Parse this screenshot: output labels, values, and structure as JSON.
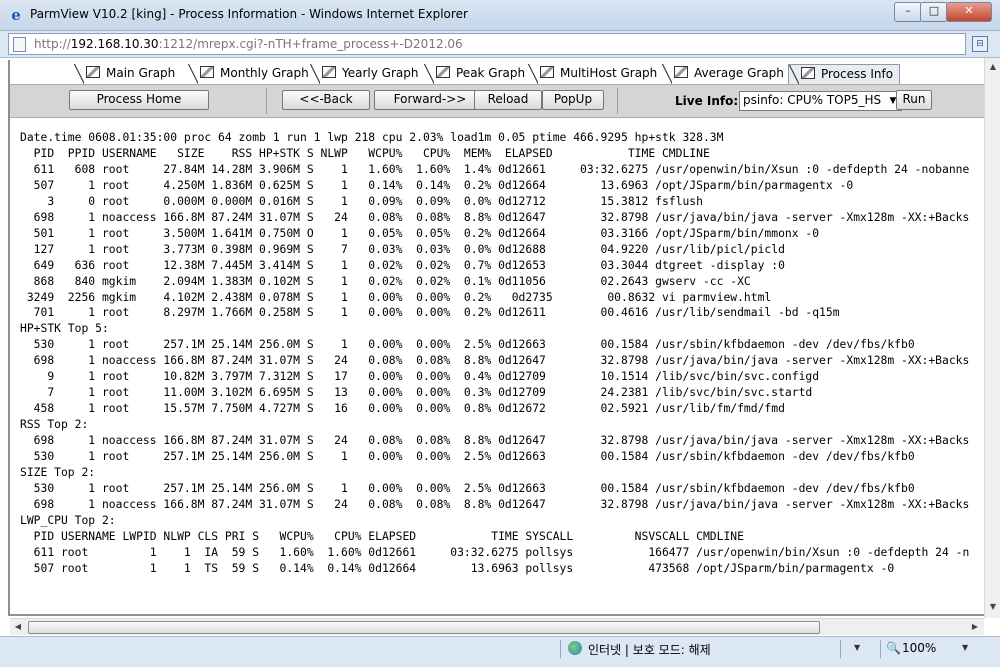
{
  "window": {
    "title": "ParmView V10.2 [king] - Process Information - Windows Internet Explorer"
  },
  "address": {
    "url_prefix": "http://",
    "host": "192.168.10.30",
    "url_rest": ":1212/mrepx.cgi?-nTH+frame_process+-D2012.06"
  },
  "tabs": [
    "Main Graph",
    "Monthly Graph",
    "Yearly Graph",
    "Peak Graph",
    "MultiHost Graph",
    "Average Graph",
    "Process Info"
  ],
  "toolbar": {
    "process_home": "Process Home",
    "back": "<<-Back",
    "forward": "Forward->>",
    "reload": "Reload",
    "popup": "PopUp",
    "live_info_label": "Live Info:",
    "live_info_value": "psinfo: CPU% TOP5_HS",
    "run": "Run"
  },
  "report": {
    "lines": [
      "Date.time 0608.01:35:00 proc 64 zomb 1 run 1 lwp 218 cpu 2.03% load1m 0.05 ptime 466.9295 hp+stk 328.3M",
      "  PID  PPID USERNAME   SIZE    RSS HP+STK S NLWP   WCPU%   CPU%  MEM%  ELAPSED           TIME CMDLINE",
      "  611   608 root     27.84M 14.28M 3.906M S    1   1.60%  1.60%  1.4% 0d12661     03:32.6275 /usr/openwin/bin/Xsun :0 -defdepth 24 -nobanne",
      "  507     1 root     4.250M 1.836M 0.625M S    1   0.14%  0.14%  0.2% 0d12664        13.6963 /opt/JSparm/bin/parmagentx -0",
      "    3     0 root     0.000M 0.000M 0.016M S    1   0.09%  0.09%  0.0% 0d12712        15.3812 fsflush",
      "  698     1 noaccess 166.8M 87.24M 31.07M S   24   0.08%  0.08%  8.8% 0d12647        32.8798 /usr/java/bin/java -server -Xmx128m -XX:+Backs",
      "  501     1 root     3.500M 1.641M 0.750M O    1   0.05%  0.05%  0.2% 0d12664        03.3166 /opt/JSparm/bin/mmonx -0",
      "  127     1 root     3.773M 0.398M 0.969M S    7   0.03%  0.03%  0.0% 0d12688        04.9220 /usr/lib/picl/picld",
      "  649   636 root     12.38M 7.445M 3.414M S    1   0.02%  0.02%  0.7% 0d12653        03.3044 dtgreet -display :0",
      "  868   840 mgkim    2.094M 1.383M 0.102M S    1   0.02%  0.02%  0.1% 0d11056        02.2643 gwserv -cc -XC",
      " 3249  2256 mgkim    4.102M 2.438M 0.078M S    1   0.00%  0.00%  0.2%   0d2735        00.8632 vi parmview.html",
      "  701     1 root     8.297M 1.766M 0.258M S    1   0.00%  0.00%  0.2% 0d12611        00.4616 /usr/lib/sendmail -bd -q15m",
      "HP+STK Top 5:",
      "  530     1 root     257.1M 25.14M 256.0M S    1   0.00%  0.00%  2.5% 0d12663        00.1584 /usr/sbin/kfbdaemon -dev /dev/fbs/kfb0",
      "  698     1 noaccess 166.8M 87.24M 31.07M S   24   0.08%  0.08%  8.8% 0d12647        32.8798 /usr/java/bin/java -server -Xmx128m -XX:+Backs",
      "    9     1 root     10.82M 3.797M 7.312M S   17   0.00%  0.00%  0.4% 0d12709        10.1514 /lib/svc/bin/svc.configd",
      "    7     1 root     11.00M 3.102M 6.695M S   13   0.00%  0.00%  0.3% 0d12709        24.2381 /lib/svc/bin/svc.startd",
      "  458     1 root     15.57M 7.750M 4.727M S   16   0.00%  0.00%  0.8% 0d12672        02.5921 /usr/lib/fm/fmd/fmd",
      "RSS Top 2:",
      "  698     1 noaccess 166.8M 87.24M 31.07M S   24   0.08%  0.08%  8.8% 0d12647        32.8798 /usr/java/bin/java -server -Xmx128m -XX:+Backs",
      "  530     1 root     257.1M 25.14M 256.0M S    1   0.00%  0.00%  2.5% 0d12663        00.1584 /usr/sbin/kfbdaemon -dev /dev/fbs/kfb0",
      "SIZE Top 2:",
      "  530     1 root     257.1M 25.14M 256.0M S    1   0.00%  0.00%  2.5% 0d12663        00.1584 /usr/sbin/kfbdaemon -dev /dev/fbs/kfb0",
      "  698     1 noaccess 166.8M 87.24M 31.07M S   24   0.08%  0.08%  8.8% 0d12647        32.8798 /usr/java/bin/java -server -Xmx128m -XX:+Backs",
      "LWP_CPU Top 2:",
      "  PID USERNAME LWPID NLWP CLS PRI S   WCPU%   CPU% ELAPSED           TIME SYSCALL         NSVSCALL CMDLINE",
      "  611 root         1    1  IA  59 S   1.60%  1.60% 0d12661     03:32.6275 pollsys           166477 /usr/openwin/bin/Xsun :0 -defdepth 24 -n",
      "  507 root         1    1  TS  59 S   0.14%  0.14% 0d12664        13.6963 pollsys           473568 /opt/JSparm/bin/parmagentx -0"
    ]
  },
  "status": {
    "zone": "인터넷 | 보호 모드: 해제",
    "zoom": "100%"
  },
  "icons": {
    "ie": "ie-logo-icon",
    "page": "page-icon",
    "compat": "compatibility-view-icon",
    "tab": "graph-tab-icon",
    "globe": "internet-zone-icon",
    "zoom": "zoom-icon"
  }
}
